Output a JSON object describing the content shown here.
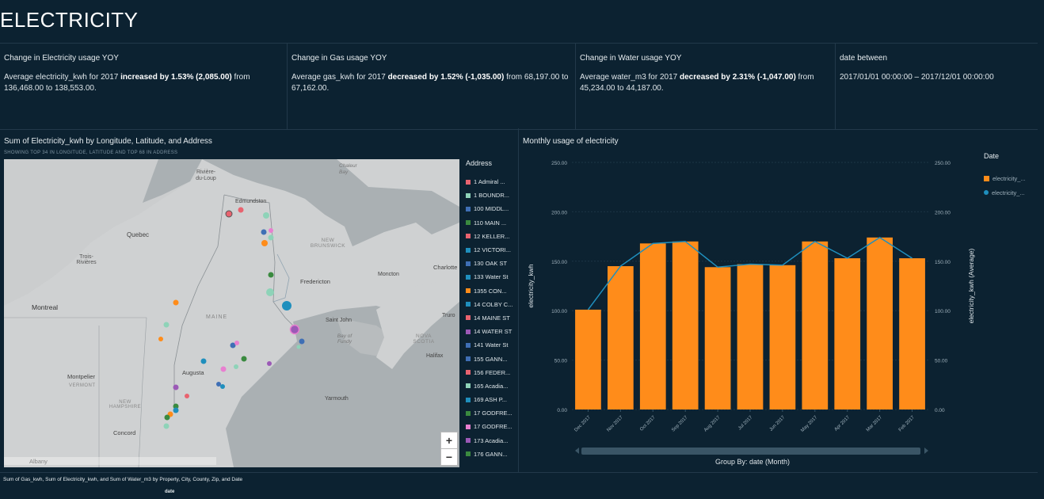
{
  "page": {
    "title": "ELECTRICITY"
  },
  "kpis": [
    {
      "title": "Change in Electricity usage YOY",
      "pre": "Average electricity_kwh for 2017 ",
      "bold": "increased by 1.53% (2,085.00)",
      "post": " from 136,468.00 to 138,553.00."
    },
    {
      "title": "Change in Gas usage YOY",
      "pre": "Average gas_kwh for 2017 ",
      "bold": "decreased by 1.52% (-1,035.00)",
      "post": " from 68,197.00 to 67,162.00."
    },
    {
      "title": "Change in Water usage YOY",
      "pre": "Average water_m3 for 2017 ",
      "bold": "decreased by 2.31% (-1,047.00)",
      "post": " from 45,234.00 to 44,187.00."
    },
    {
      "title": "date between",
      "pre": "2017/01/01 00:00:00 – 2017/12/01 00:00:00",
      "bold": "",
      "post": ""
    }
  ],
  "map_panel": {
    "title": "Sum of Electricity_kwh by Longitude, Latitude, and Address",
    "subtitle": "SHOWING TOP 34 IN LONGITUDE, LATITUDE AND TOP 68 IN ADDRESS",
    "place_labels": [
      "Rivière-du-Loup",
      "Chaleur Bay",
      "Edmundston",
      "Quebec",
      "NEW BRUNSWICK",
      "Trois-Rivières",
      "Fredericton",
      "Moncton",
      "Charlotte",
      "Montreal",
      "MAINE",
      "Saint John",
      "Truro",
      "NOVA SCOTIA",
      "Bay of Fundy",
      "Halifax",
      "Montpelier",
      "VERMONT",
      "Augusta",
      "Yarmouth",
      "NEW HAMPSHIRE",
      "Concord",
      "Albany"
    ],
    "zoom_in": "+",
    "zoom_out": "−"
  },
  "legend": {
    "title": "Address",
    "items": [
      {
        "label": "1 Admiral ...",
        "color": "#e8636f"
      },
      {
        "label": "1 BOUNDR...",
        "color": "#8ed3b8"
      },
      {
        "label": "100 MIDDL...",
        "color": "#3f6fb5"
      },
      {
        "label": "110 MAIN ...",
        "color": "#3a8a3f"
      },
      {
        "label": "12 KELLER...",
        "color": "#e8636f"
      },
      {
        "label": "12 VICTORI...",
        "color": "#1f8fbd"
      },
      {
        "label": "130 OAK ST",
        "color": "#3f6fb5"
      },
      {
        "label": "133 Water St",
        "color": "#1f8fbd"
      },
      {
        "label": "1355 CON...",
        "color": "#ff8c1a"
      },
      {
        "label": "14 COLBY C...",
        "color": "#1f8fbd"
      },
      {
        "label": "14 MAINE ST",
        "color": "#e8636f"
      },
      {
        "label": "14 WATER ST",
        "color": "#9b59b6"
      },
      {
        "label": "141 Water St",
        "color": "#3f6fb5"
      },
      {
        "label": "155 GANN...",
        "color": "#3f6fb5"
      },
      {
        "label": "156 FEDER...",
        "color": "#e8636f"
      },
      {
        "label": "165 Acadia...",
        "color": "#8ed3b8"
      },
      {
        "label": "169 ASH P...",
        "color": "#1f8fbd"
      },
      {
        "label": "17 GODFRE...",
        "color": "#3a8a3f"
      },
      {
        "label": "17 GODFRE...",
        "color": "#e87fd0"
      },
      {
        "label": "173 Acadia...",
        "color": "#9b59b6"
      },
      {
        "label": "176 GANN...",
        "color": "#3a8a3f"
      }
    ]
  },
  "chart_panel": {
    "title": "Monthly usage of electricity",
    "group_by": "Group By: date (Month)",
    "legend_title": "Date",
    "legend_items": [
      {
        "label": "electricity_...",
        "color": "#ff8c1a",
        "shape": "square"
      },
      {
        "label": "electricity_...",
        "color": "#1f8fbd",
        "shape": "circle"
      }
    ]
  },
  "chart_data": {
    "type": "bar",
    "categories": [
      "Dec 2017",
      "Nov 2017",
      "Oct 2017",
      "Sep 2017",
      "Aug 2017",
      "Jul 2017",
      "Jun 2017",
      "May 2017",
      "Apr 2017",
      "Mar 2017",
      "Feb 2017"
    ],
    "series": [
      {
        "type": "bar",
        "values": [
          101,
          145,
          168,
          170,
          144,
          147,
          146,
          170,
          153,
          174,
          153
        ],
        "color": "#ff8c1a"
      },
      {
        "type": "line",
        "values": [
          101,
          145,
          168,
          170,
          144,
          147,
          146,
          170,
          153,
          174,
          153
        ],
        "color": "#1f8fbd"
      }
    ],
    "ylabel": "electricity_kwh",
    "y2label": "electricity_kwh (Average)",
    "ylim": [
      0,
      250
    ],
    "yticks": [
      "0.00",
      "50.00",
      "100.00",
      "150.00",
      "200.00",
      "250.00"
    ]
  },
  "bottom_panel": {
    "title": "Sum of Gas_kwh, Sum of Electricity_kwh, and Sum of Water_m3 by Property, City, County, Zip, and Date",
    "column": "date"
  }
}
